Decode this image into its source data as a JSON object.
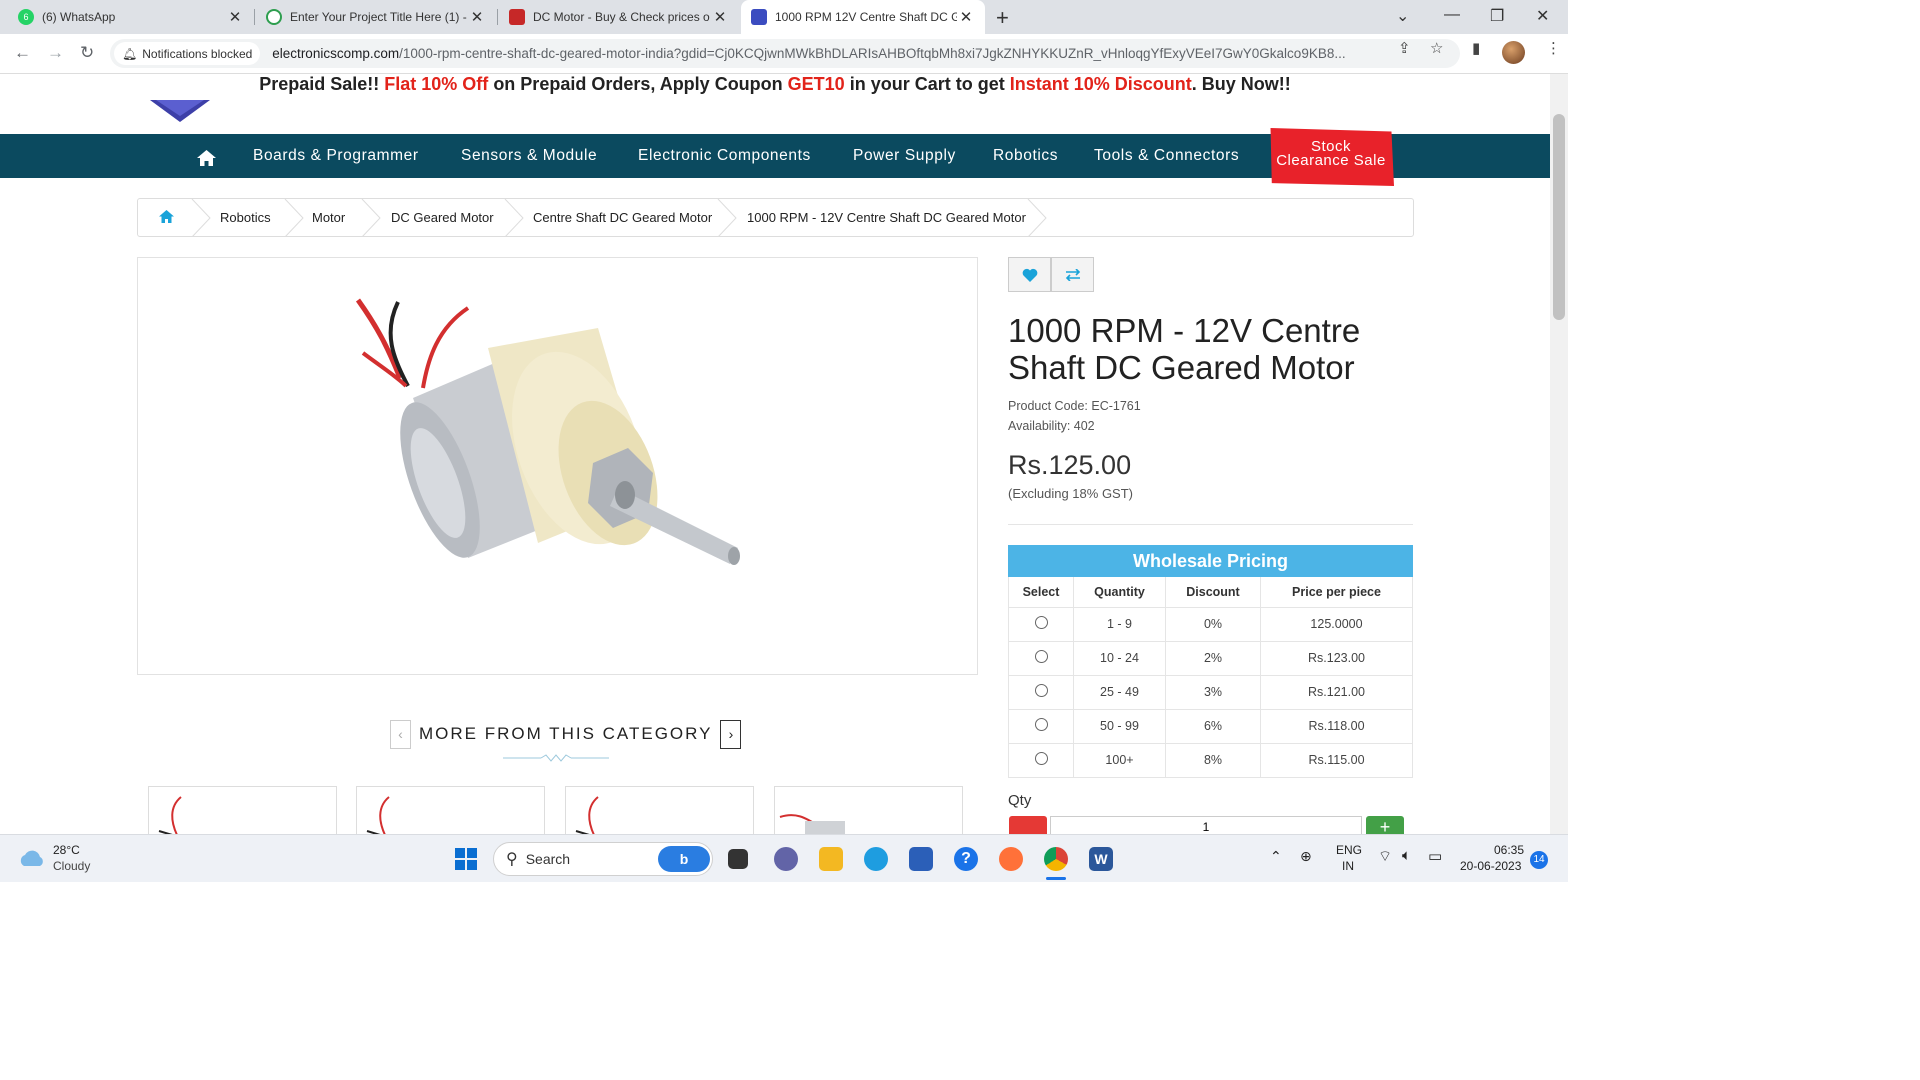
{
  "browser": {
    "tabs": [
      {
        "title": "(6) WhatsApp",
        "favicon_color": "#25d366",
        "badge": "6"
      },
      {
        "title": "Enter Your Project Title Here (1) -",
        "favicon_color": "#2e9e4f"
      },
      {
        "title": "DC Motor - Buy & Check prices o",
        "favicon_color": "#c62828"
      },
      {
        "title": "1000 RPM 12V Centre Shaft DC G",
        "favicon_color": "#3b4cc0",
        "active": true
      }
    ],
    "notifications_chip": "Notifications blocked",
    "url_host": "electronicscomp.com",
    "url_path": "/1000-rpm-centre-shaft-dc-geared-motor-india?gdid=Cj0KCQjwnMWkBhDLARIsAHBOftqbMh8xi7JgkZNHYKKUZnR_vHnloqgYfExyVEeI7GwY0Gkalco9KB8..."
  },
  "promo": {
    "part1": "Prepaid Sale!! ",
    "part2": "Flat 10% Off",
    "part3": " on Prepaid Orders, Apply Coupon ",
    "coupon": " GET10 ",
    "part4": " in your Cart to get ",
    "part5": "Instant 10% Discount",
    "part6": ". Buy Now!!"
  },
  "nav": {
    "items": [
      "Boards & Programmer",
      "Sensors & Module",
      "Electronic Components",
      "Power Supply",
      "Robotics",
      "Tools & Connectors"
    ],
    "stock_line1": "Stock",
    "stock_line2": "Clearance Sale"
  },
  "breadcrumb": [
    "Robotics",
    "Motor",
    "DC Geared Motor",
    "Centre Shaft DC Geared Motor",
    "1000 RPM - 12V Centre Shaft DC Geared Motor"
  ],
  "more_category": "MORE FROM THIS CATEGORY",
  "product": {
    "title": "1000 RPM - 12V Centre Shaft DC Geared Motor",
    "code_label": "Product Code: EC-1761",
    "availability_label": "Availability: 402",
    "price": "Rs.125.00",
    "price_note": "(Excluding 18% GST)"
  },
  "wholesale": {
    "heading": "Wholesale Pricing",
    "columns": [
      "Select",
      "Quantity",
      "Discount",
      "Price per piece"
    ],
    "rows": [
      {
        "qty": "1 - 9",
        "discount": "0%",
        "price": "125.0000"
      },
      {
        "qty": "10 - 24",
        "discount": "2%",
        "price": "Rs.123.00"
      },
      {
        "qty": "25 - 49",
        "discount": "3%",
        "price": "Rs.121.00"
      },
      {
        "qty": "50 - 99",
        "discount": "6%",
        "price": "Rs.118.00"
      },
      {
        "qty": "100+",
        "discount": "8%",
        "price": "Rs.115.00"
      }
    ]
  },
  "qty": {
    "label": "Qty",
    "value": "1"
  },
  "taskbar": {
    "weather_temp": "28°C",
    "weather_desc": "Cloudy",
    "search_label": "Search",
    "lang1": "ENG",
    "lang2": "IN",
    "time": "06:35",
    "date": "20-06-2023",
    "notif_count": "14"
  }
}
